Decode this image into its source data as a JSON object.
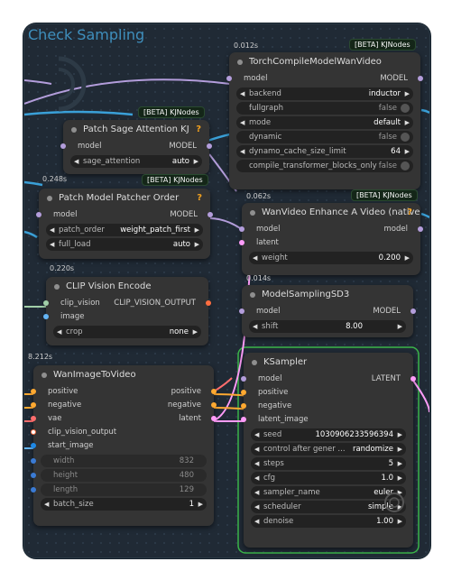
{
  "group": {
    "title": "Check Sampling"
  },
  "colors": {
    "model": "#b39ddb",
    "clip_vision": "#a1cfa8",
    "image": "#64b5f6",
    "latent": "#ff9cf9",
    "conditioning": "#ffa931",
    "vae": "#ff6e6e",
    "int": "#3a7bd5",
    "group_border": "#3bb54a"
  },
  "compile": {
    "timing": "0.012s",
    "badge": "[BETA] KJNodes",
    "title": "TorchCompileModelWanVideo",
    "input": "model",
    "output": "MODEL",
    "widgets": [
      {
        "label": "backend",
        "value": "inductor",
        "kind": "combo"
      },
      {
        "label": "fullgraph",
        "value": "false",
        "kind": "toggle"
      },
      {
        "label": "mode",
        "value": "default",
        "kind": "combo"
      },
      {
        "label": "dynamic",
        "value": "false",
        "kind": "toggle"
      },
      {
        "label": "dynamo_cache_size_limit",
        "value": "64",
        "kind": "combo"
      },
      {
        "label": "compile_transformer_blocks_only",
        "value": "false",
        "kind": "toggle"
      }
    ]
  },
  "sage": {
    "badge": "[BETA] KJNodes",
    "title": "Patch Sage Attention KJ",
    "help": "?",
    "input": "model",
    "output": "MODEL",
    "widget": {
      "label": "sage_attention",
      "value": "auto"
    }
  },
  "patcher": {
    "timing": "0.248s",
    "badge": "[BETA] KJNodes",
    "title": "Patch Model Patcher Order",
    "help": "?",
    "input": "model",
    "output": "MODEL",
    "widgets": [
      {
        "label": "patch_order",
        "value": "weight_patch_first"
      },
      {
        "label": "full_load",
        "value": "auto"
      }
    ]
  },
  "enhance": {
    "timing": "0.062s",
    "badge": "[BETA] KJNodes",
    "title": "WanVideo Enhance A Video (native)",
    "help": "?",
    "inputs": [
      "model",
      "latent"
    ],
    "output": "model",
    "widget": {
      "label": "weight",
      "value": "0.200"
    }
  },
  "clipvision": {
    "timing": "0.220s",
    "title": "CLIP Vision Encode",
    "inputs": [
      "clip_vision",
      "image"
    ],
    "output": "CLIP_VISION_OUTPUT",
    "widget": {
      "label": "crop",
      "value": "none"
    }
  },
  "msd3": {
    "timing": "0.014s",
    "title": "ModelSamplingSD3",
    "input": "model",
    "output": "MODEL",
    "widget": {
      "label": "shift",
      "value": "8.00"
    }
  },
  "wanimg": {
    "timing": "8.212s",
    "title": "WanImageToVideo",
    "inputs": [
      "positive",
      "negative",
      "vae",
      "clip_vision_output",
      "start_image"
    ],
    "outputs": [
      "positive",
      "negative",
      "latent"
    ],
    "dim_widgets": [
      {
        "label": "width",
        "value": "832"
      },
      {
        "label": "height",
        "value": "480"
      },
      {
        "label": "length",
        "value": "129"
      }
    ],
    "widget": {
      "label": "batch_size",
      "value": "1"
    }
  },
  "ksampler": {
    "title": "KSampler",
    "inputs": [
      "model",
      "positive",
      "negative",
      "latent_image"
    ],
    "output": "LATENT",
    "widgets": [
      {
        "label": "seed",
        "value": "1030906233596394"
      },
      {
        "label": "control after gener ...",
        "value": "randomize"
      },
      {
        "label": "steps",
        "value": "5"
      },
      {
        "label": "cfg",
        "value": "1.0"
      },
      {
        "label": "sampler_name",
        "value": "euler"
      },
      {
        "label": "scheduler",
        "value": "simple"
      },
      {
        "label": "denoise",
        "value": "1.00"
      }
    ]
  }
}
